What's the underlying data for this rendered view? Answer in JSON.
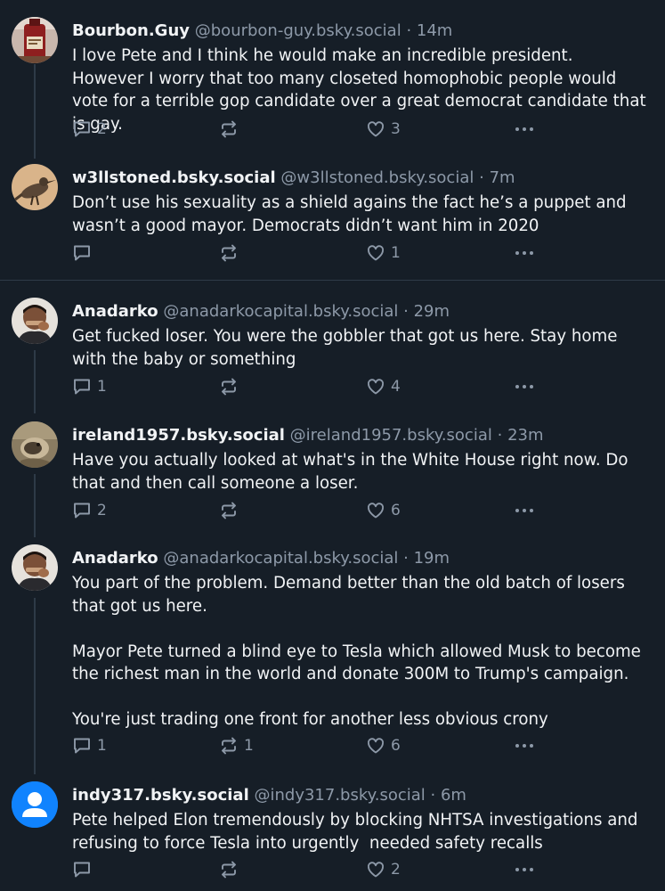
{
  "posts": [
    {
      "display_name": "Bourbon.Guy",
      "handle": "@bourbon-guy.bsky.social",
      "dot": "·",
      "time": "14m",
      "text": "I love Pete and I think he would make an incredible president. However I worry that too many closeted homophobic people would vote for a terrible gop candidate over a great democrat candidate that is gay.",
      "replies": "2",
      "reposts": "",
      "likes": "3",
      "avatar_icon": "bourbon-bottle-avatar"
    },
    {
      "display_name": "w3llstoned.bsky.social",
      "handle": "@w3llstoned.bsky.social",
      "dot": "·",
      "time": "7m",
      "text": "Don’t use his sexuality as a shield agains the fact he’s a puppet and wasn’t a good mayor. Democrats didn’t want him in 2020",
      "replies": "",
      "reposts": "",
      "likes": "1",
      "avatar_icon": "roadrunner-avatar"
    },
    {
      "display_name": "Anadarko",
      "handle": "@anadarkocapital.bsky.social",
      "dot": "·",
      "time": "29m",
      "text": "Get fucked loser. You were the gobbler that got us here. Stay home with the baby or something",
      "replies": "1",
      "reposts": "",
      "likes": "4",
      "avatar_icon": "man-facepalm-avatar"
    },
    {
      "display_name": "ireland1957.bsky.social",
      "handle": "@ireland1957.bsky.social",
      "dot": "·",
      "time": "23m",
      "text": "Have you actually looked at what's in the White House right now. Do that and then call someone a loser.",
      "replies": "2",
      "reposts": "",
      "likes": "6",
      "avatar_icon": "cat-avatar"
    },
    {
      "display_name": "Anadarko",
      "handle": "@anadarkocapital.bsky.social",
      "dot": "·",
      "time": "19m",
      "text": "You part of the problem. Demand better than the old batch of losers that got us here.\n\nMayor Pete turned a blind eye to Tesla which allowed Musk to become the richest man in the world and donate 300M to Trump's campaign.\n\nYou're just trading one front for another less obvious crony",
      "replies": "1",
      "reposts": "1",
      "likes": "6",
      "avatar_icon": "man-facepalm-avatar"
    },
    {
      "display_name": "indy317.bsky.social",
      "handle": "@indy317.bsky.social",
      "dot": "·",
      "time": "6m",
      "text": "Pete helped Elon tremendously by blocking NHTSA investigations and refusing to force Tesla into urgently  needed safety recalls",
      "replies": "",
      "reposts": "",
      "likes": "2",
      "avatar_icon": "default-user-avatar"
    }
  ],
  "colors": {
    "background": "#161e27",
    "text": "#f1f3f5",
    "muted": "#8d99a8",
    "divider": "#2e3a47",
    "default_avatar": "#1083fe"
  }
}
